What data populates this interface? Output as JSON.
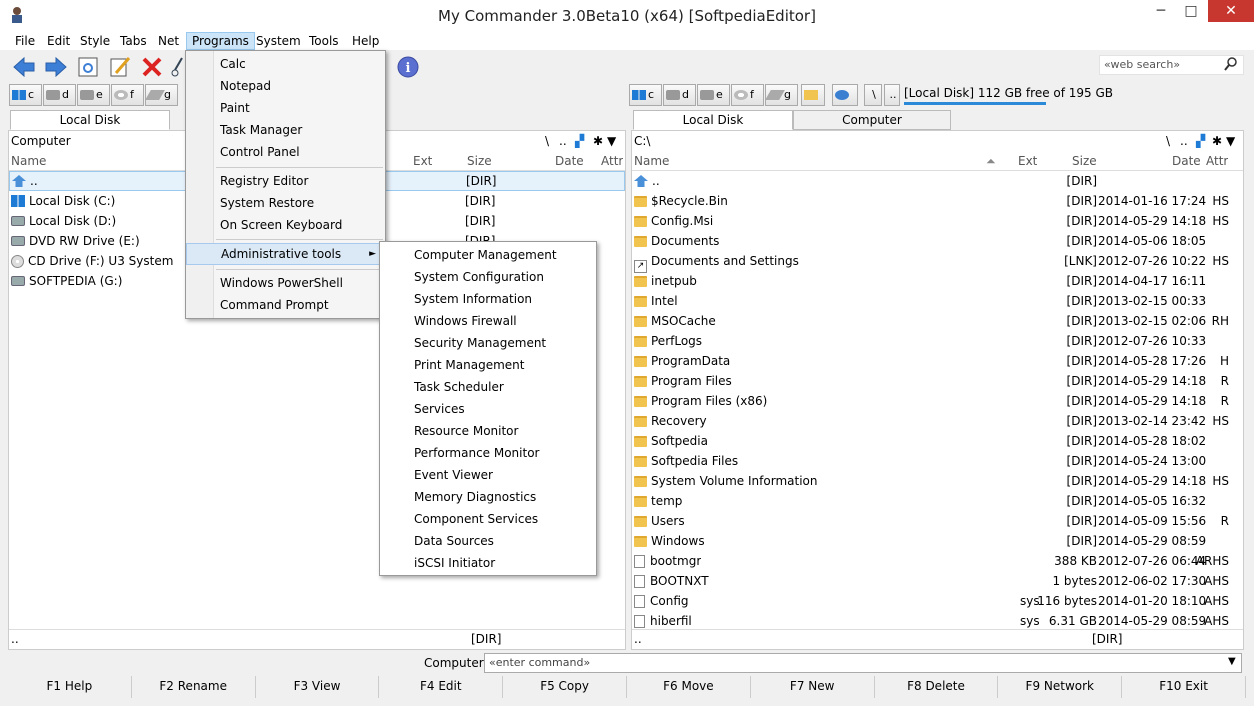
{
  "window": {
    "title": "My Commander 3.0Beta10 (x64) [SoftpediaEditor]",
    "min": "─",
    "max": "□",
    "close": "✕"
  },
  "menu": [
    "File",
    "Edit",
    "Style",
    "Tabs",
    "Net",
    "Programs",
    "System",
    "Tools",
    "Help"
  ],
  "search": {
    "placeholder": "«web search»"
  },
  "left_drives": [
    "c",
    "d",
    "e",
    "f",
    "g"
  ],
  "right_drives": [
    "c",
    "d",
    "e",
    "f",
    "g"
  ],
  "right_path_buttons": [
    "\\",
    ".."
  ],
  "right_free": "[Local Disk] 112 GB free of 195 GB",
  "left": {
    "tab": "Local Disk",
    "path": "Computer",
    "path_buttons": [
      "\\",
      ".."
    ],
    "columns": {
      "name": "Name",
      "ext": "Ext",
      "size": "Size",
      "date": "Date",
      "attr": "Attr"
    },
    "rows": [
      {
        "name": "..",
        "size": "[DIR]",
        "icon": "up"
      },
      {
        "name": "Local Disk (C:)",
        "size": "[DIR]",
        "icon": "win"
      },
      {
        "name": "Local Disk (D:)",
        "size": "[DIR]",
        "icon": "drive"
      },
      {
        "name": "DVD RW Drive (E:)",
        "size": "[DIR]",
        "icon": "drive"
      },
      {
        "name": "CD Drive (F:) U3 System",
        "size": "[DIR]",
        "icon": "cd"
      },
      {
        "name": "SOFTPEDIA (G:)",
        "size": "[DIR]",
        "icon": "drive"
      }
    ],
    "status_left": "..",
    "status_right": "[DIR]"
  },
  "right": {
    "tabs": [
      "Local Disk",
      "Computer"
    ],
    "path": "C:\\",
    "path_buttons": [
      "\\",
      ".."
    ],
    "columns": {
      "name": "Name",
      "ext": "Ext",
      "size": "Size",
      "date": "Date",
      "attr": "Attr"
    },
    "rows": [
      {
        "name": "..",
        "ext": "",
        "size": "[DIR]",
        "date": "",
        "attr": "",
        "icon": "up"
      },
      {
        "name": "$Recycle.Bin",
        "ext": "",
        "size": "[DIR]",
        "date": "2014-01-16 17:24",
        "attr": "HS",
        "icon": "folder"
      },
      {
        "name": "Config.Msi",
        "ext": "",
        "size": "[DIR]",
        "date": "2014-05-29 14:18",
        "attr": "HS",
        "icon": "folder"
      },
      {
        "name": "Documents",
        "ext": "",
        "size": "[DIR]",
        "date": "2014-05-06 18:05",
        "attr": "",
        "icon": "folder"
      },
      {
        "name": "Documents and Settings",
        "ext": "",
        "size": "[LNK]",
        "date": "2012-07-26 10:22",
        "attr": "HS",
        "icon": "link"
      },
      {
        "name": "inetpub",
        "ext": "",
        "size": "[DIR]",
        "date": "2014-04-17 16:11",
        "attr": "",
        "icon": "folder"
      },
      {
        "name": "Intel",
        "ext": "",
        "size": "[DIR]",
        "date": "2013-02-15 00:33",
        "attr": "",
        "icon": "folder"
      },
      {
        "name": "MSOCache",
        "ext": "",
        "size": "[DIR]",
        "date": "2013-02-15 02:06",
        "attr": "RH",
        "icon": "folder"
      },
      {
        "name": "PerfLogs",
        "ext": "",
        "size": "[DIR]",
        "date": "2012-07-26 10:33",
        "attr": "",
        "icon": "folder"
      },
      {
        "name": "ProgramData",
        "ext": "",
        "size": "[DIR]",
        "date": "2014-05-28 17:26",
        "attr": "H",
        "icon": "folder"
      },
      {
        "name": "Program Files",
        "ext": "",
        "size": "[DIR]",
        "date": "2014-05-29 14:18",
        "attr": "R",
        "icon": "folder"
      },
      {
        "name": "Program Files (x86)",
        "ext": "",
        "size": "[DIR]",
        "date": "2014-05-29 14:18",
        "attr": "R",
        "icon": "folder"
      },
      {
        "name": "Recovery",
        "ext": "",
        "size": "[DIR]",
        "date": "2013-02-14 23:42",
        "attr": "HS",
        "icon": "folder"
      },
      {
        "name": "Softpedia",
        "ext": "",
        "size": "[DIR]",
        "date": "2014-05-28 18:02",
        "attr": "",
        "icon": "folder"
      },
      {
        "name": "Softpedia Files",
        "ext": "",
        "size": "[DIR]",
        "date": "2014-05-24 13:00",
        "attr": "",
        "icon": "folder"
      },
      {
        "name": "System Volume Information",
        "ext": "",
        "size": "[DIR]",
        "date": "2014-05-29 14:18",
        "attr": "HS",
        "icon": "folder"
      },
      {
        "name": "temp",
        "ext": "",
        "size": "[DIR]",
        "date": "2014-05-05 16:32",
        "attr": "",
        "icon": "folder"
      },
      {
        "name": "Users",
        "ext": "",
        "size": "[DIR]",
        "date": "2014-05-09 15:56",
        "attr": "R",
        "icon": "folder"
      },
      {
        "name": "Windows",
        "ext": "",
        "size": "[DIR]",
        "date": "2014-05-29 08:59",
        "attr": "",
        "icon": "folder"
      },
      {
        "name": "bootmgr",
        "ext": "",
        "size": "388 KB",
        "date": "2012-07-26 06:44",
        "attr": "ARHS",
        "icon": "file"
      },
      {
        "name": "BOOTNXT",
        "ext": "",
        "size": "1 bytes",
        "date": "2012-06-02 17:30",
        "attr": "AHS",
        "icon": "file"
      },
      {
        "name": "Config",
        "ext": "sys",
        "size": "116 bytes",
        "date": "2014-01-20 18:10",
        "attr": "AHS",
        "icon": "sysfile"
      },
      {
        "name": "hiberfil",
        "ext": "sys",
        "size": "6.31 GB",
        "date": "2014-05-29 08:59",
        "attr": "AHS",
        "icon": "sysfile"
      }
    ],
    "status_left": "..",
    "status_right": "[DIR]"
  },
  "programs_menu": {
    "group1": [
      "Calc",
      "Notepad",
      "Paint",
      "Task Manager",
      "Control Panel"
    ],
    "group2": [
      "Registry Editor",
      "System Restore",
      "On Screen Keyboard"
    ],
    "group3": [
      "Administrative tools"
    ],
    "group4": [
      "Windows PowerShell",
      "Command Prompt"
    ]
  },
  "admin_submenu": [
    "Computer Management",
    "System Configuration",
    "System Information",
    "Windows Firewall",
    "Security Management",
    "Print Management",
    "Task Scheduler",
    "Services",
    "Resource Monitor",
    "Performance Monitor",
    "Event Viewer",
    "Memory Diagnostics",
    "Component Services",
    "Data Sources",
    "iSCSI Initiator"
  ],
  "command": {
    "label": "Computer",
    "placeholder": "«enter command»"
  },
  "fkeys": [
    "F1 Help",
    "F2 Rename",
    "F3 View",
    "F4 Edit",
    "F5 Copy",
    "F6 Move",
    "F7 New",
    "F8 Delete",
    "F9 Network",
    "F10 Exit"
  ]
}
